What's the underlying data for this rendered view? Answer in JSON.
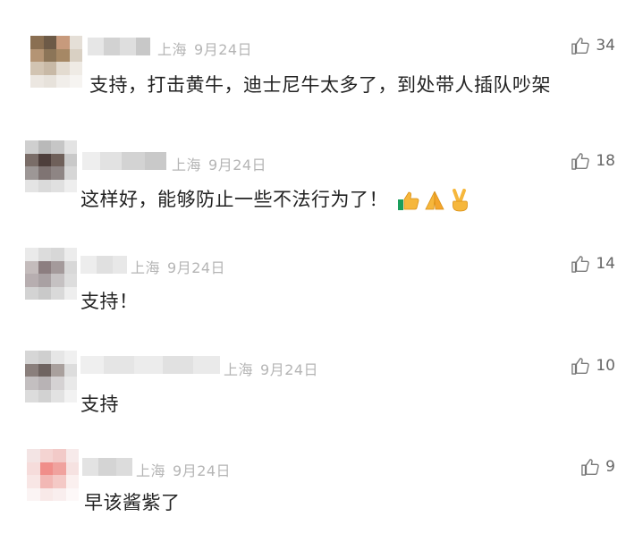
{
  "comments": [
    {
      "location": "上海",
      "date": "9月24日",
      "text": "支持，打击黄牛，迪士尼牛太多了，到处带人插队吵架",
      "likes": "34"
    },
    {
      "location": "上海",
      "date": "9月24日",
      "text": "这样好，能够防止一些不法行为了！",
      "likes": "18",
      "emojis": [
        "thumbs-up-icon",
        "folded-hands-icon",
        "victory-hand-icon"
      ]
    },
    {
      "location": "上海",
      "date": "9月24日",
      "text": "支持！",
      "likes": "14"
    },
    {
      "location": "上海",
      "date": "9月24日",
      "text": "支持",
      "likes": "10"
    },
    {
      "location": "上海",
      "date": "9月24日",
      "text": "早该酱紫了",
      "likes": "9"
    }
  ]
}
